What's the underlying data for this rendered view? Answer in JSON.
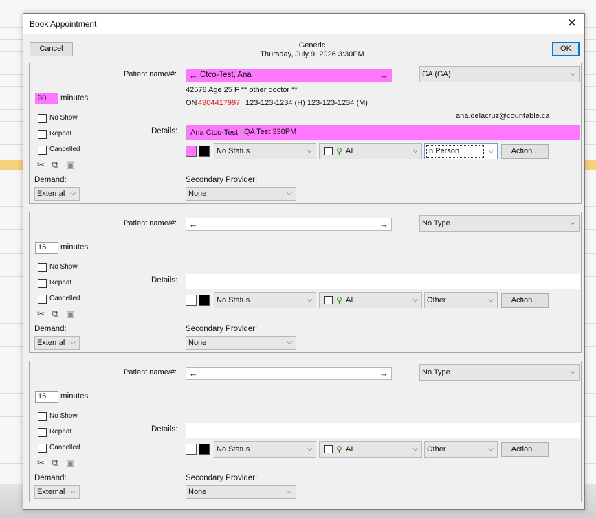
{
  "dialog": {
    "title": "Book Appointment",
    "cancel": "Cancel",
    "ok": "OK",
    "provider": "Generic",
    "datetime": "Thursday, July 9, 2026 3:30PM"
  },
  "labels": {
    "patient": "Patient name/#:",
    "minutes": "minutes",
    "no_show": "No Show",
    "repeat": "Repeat",
    "cancelled": "Cancelled",
    "details": "Details:",
    "demand": "Demand:",
    "secondary": "Secondary Provider:",
    "action": "Action...",
    "ai": "AI"
  },
  "appointments": [
    {
      "patient_name": "Ctco-Test, Ana",
      "type": "GA (GA)",
      "minutes": "30",
      "info": "42578  Age 25  F  ** other doctor **",
      "phone_prefix": "ON",
      "health_no": "4904417997",
      "phones": "123-123-1234 (H)   123-123-1234 (M)",
      "comma": ",",
      "email": "ana.delacruz@countable.ca",
      "detail_name": "Ana Ctco-Test",
      "detail_text": "QA Test 330PM",
      "status": "No Status",
      "visit": "In Person",
      "demand": "External",
      "secondary": "None",
      "color": "#ff77ff"
    },
    {
      "patient_name": "",
      "type": "No Type",
      "minutes": "15",
      "status": "No Status",
      "visit": "Other",
      "demand": "External",
      "secondary": "None"
    },
    {
      "patient_name": "",
      "type": "No Type",
      "minutes": "15",
      "status": "No Status",
      "visit": "Other",
      "demand": "External",
      "secondary": "None"
    }
  ],
  "icons": [
    "scissors-icon",
    "copy-icon",
    "paste-icon",
    "arrow-left-icon",
    "arrow-right-icon",
    "hint-icon"
  ]
}
